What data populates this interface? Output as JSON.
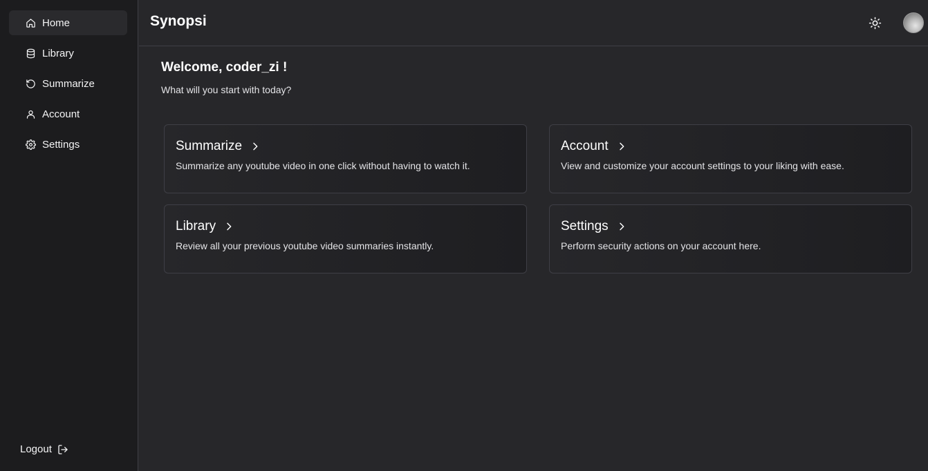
{
  "sidebar": {
    "items": [
      {
        "label": "Home",
        "icon": "home-icon",
        "active": true
      },
      {
        "label": "Library",
        "icon": "database-icon"
      },
      {
        "label": "Summarize",
        "icon": "rotate-ccw-icon"
      },
      {
        "label": "Account",
        "icon": "user-icon"
      },
      {
        "label": "Settings",
        "icon": "gear-icon"
      }
    ],
    "logout_label": "Logout"
  },
  "header": {
    "brand": "Synopsi",
    "theme_icon": "sun-icon",
    "avatar": "avatar"
  },
  "main": {
    "welcome": "Welcome, coder_zi !",
    "subtitle": "What will you start with today?",
    "cards": [
      {
        "title": "Summarize",
        "description": "Summarize any youtube video in one click without having to watch it."
      },
      {
        "title": "Account",
        "description": "View and customize your account settings to your liking with ease."
      },
      {
        "title": "Library",
        "description": "Review all your previous youtube video summaries instantly."
      },
      {
        "title": "Settings",
        "description": "Perform security actions on your account here."
      }
    ]
  },
  "colors": {
    "background": "#27272a",
    "sidebar": "#1c1c1e",
    "border": "#3f3f46",
    "active_nav": "#2a2a2d",
    "text": "#fafafa"
  }
}
